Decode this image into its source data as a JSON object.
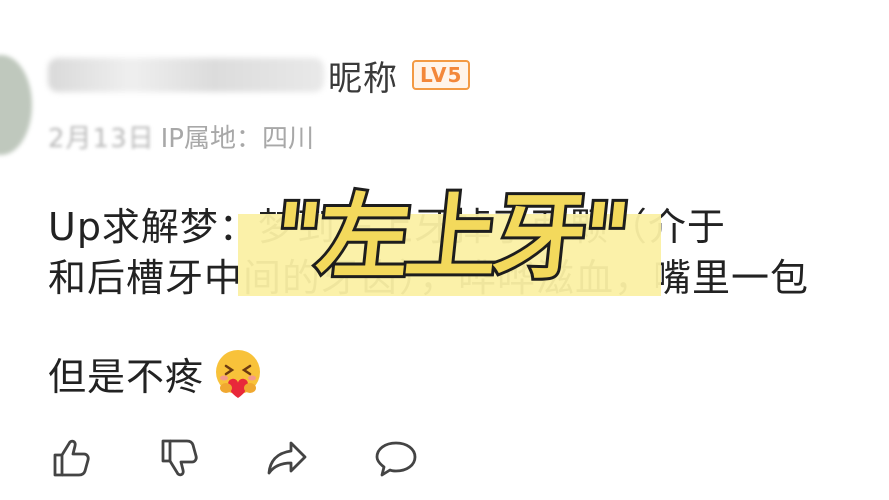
{
  "comment": {
    "nickname_suffix": "昵称",
    "level_badge": "LV5",
    "meta_date": "2月13日",
    "meta_location": "IP属地：四川",
    "text_line1": "Up求解梦：梦到左上牙掉了两颗（介于",
    "text_line2": "和后槽牙中间的牙齿），哗哗滋血，嘴里一包",
    "text_line3": "但是不疼",
    "emoji": "hugging-heart-emoji"
  },
  "overlay": {
    "text": "\"左上牙\"",
    "text_color": "#f3d95c",
    "highlight_color": "#fbf0a4"
  },
  "actions": [
    {
      "name": "like",
      "icon": "thumbs-up-icon"
    },
    {
      "name": "dislike",
      "icon": "thumbs-down-icon"
    },
    {
      "name": "share",
      "icon": "share-arrow-icon"
    },
    {
      "name": "reply",
      "icon": "comment-bubble-icon"
    }
  ]
}
